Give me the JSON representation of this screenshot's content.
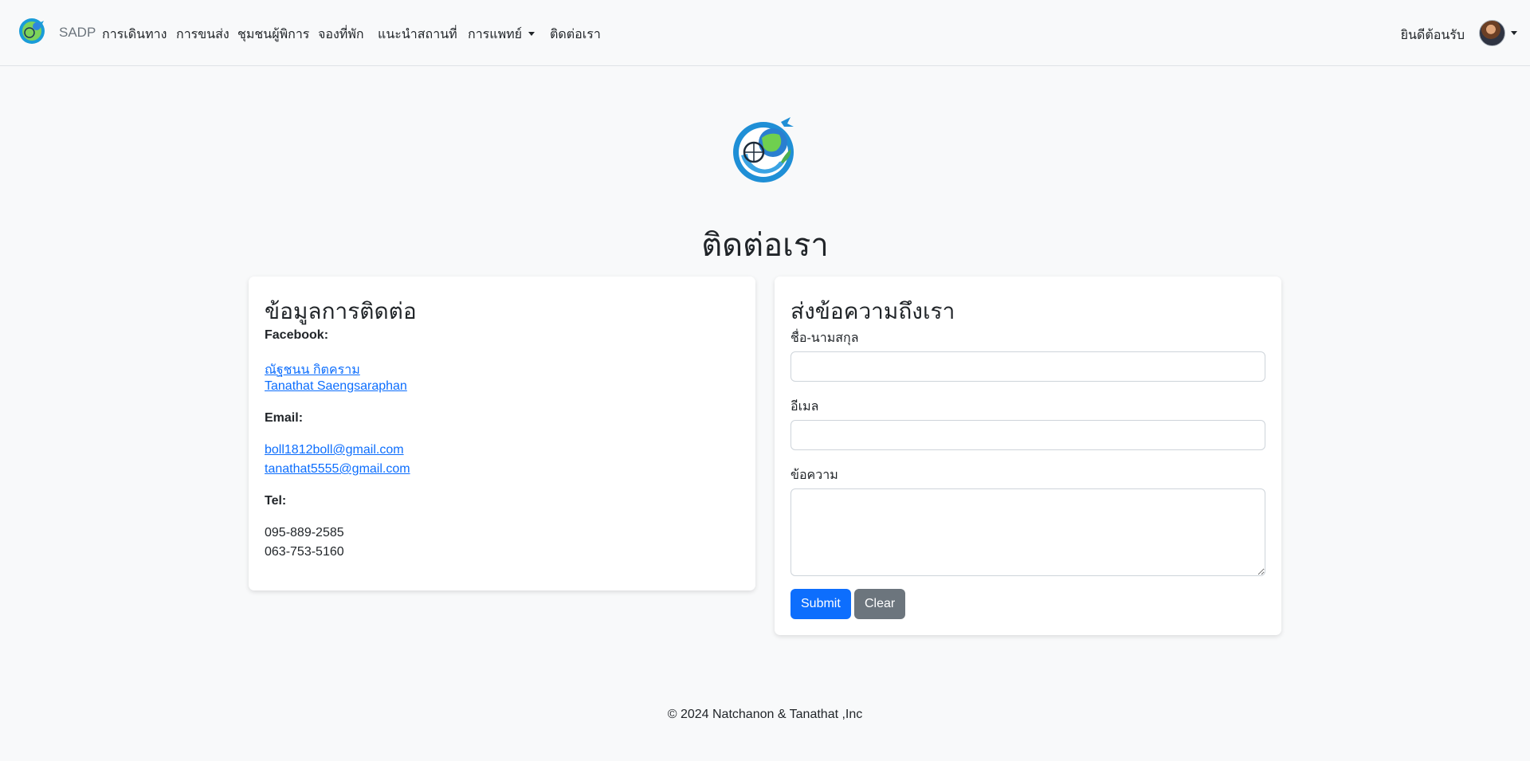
{
  "navbar": {
    "brand": "SADP",
    "links": [
      "การเดินทาง",
      "การขนส่ง",
      "ชุมชนผู้พิการ",
      "จองที่พัก",
      "แนะนำสถานที่",
      "การแพทย์",
      "ติดต่อเรา"
    ],
    "welcome": "ยินดีต้อนรับ"
  },
  "page": {
    "title": "ติดต่อเรา"
  },
  "contact_info": {
    "title": "ข้อมูลการติดต่อ",
    "facebook_label": "Facebook:",
    "facebook_links": [
      "ณัฐชนน กิตคราม",
      "Tanathat Saengsaraphan"
    ],
    "email_label": "Email:",
    "emails": [
      "boll1812boll@gmail.com",
      "tanathat5555@gmail.com"
    ],
    "tel_label": "Tel:",
    "phones": [
      "095-889-2585",
      "063-753-5160"
    ]
  },
  "contact_form": {
    "title": "ส่งข้อความถึงเรา",
    "name_label": "ชื่อ-นามสกุล",
    "name_value": "",
    "email_label": "อีเมล",
    "email_value": "",
    "message_label": "ข้อความ",
    "message_value": "",
    "submit_label": "Submit",
    "clear_label": "Clear"
  },
  "footer": {
    "text": "© 2024 Natchanon & Tanathat ,Inc"
  },
  "colors": {
    "primary": "#0d6efd",
    "secondary": "#6c757d",
    "background": "#f8f9fa"
  },
  "icons": {
    "brand": "accessible-travel-globe-logo",
    "avatar": "user-avatar"
  }
}
